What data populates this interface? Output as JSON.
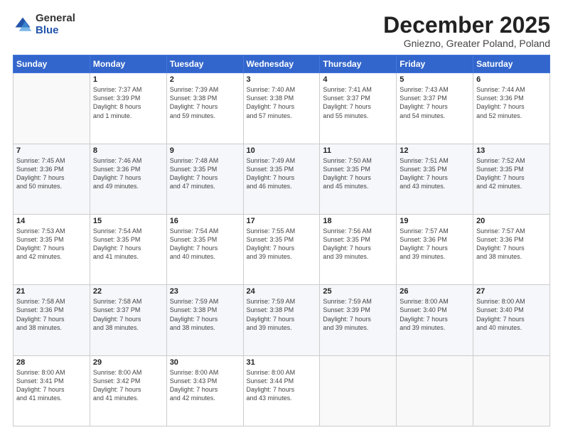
{
  "header": {
    "logo_general": "General",
    "logo_blue": "Blue",
    "title": "December 2025",
    "subtitle": "Gniezno, Greater Poland, Poland"
  },
  "weekdays": [
    "Sunday",
    "Monday",
    "Tuesday",
    "Wednesday",
    "Thursday",
    "Friday",
    "Saturday"
  ],
  "weeks": [
    [
      {
        "num": "",
        "info": ""
      },
      {
        "num": "1",
        "info": "Sunrise: 7:37 AM\nSunset: 3:39 PM\nDaylight: 8 hours\nand 1 minute."
      },
      {
        "num": "2",
        "info": "Sunrise: 7:39 AM\nSunset: 3:38 PM\nDaylight: 7 hours\nand 59 minutes."
      },
      {
        "num": "3",
        "info": "Sunrise: 7:40 AM\nSunset: 3:38 PM\nDaylight: 7 hours\nand 57 minutes."
      },
      {
        "num": "4",
        "info": "Sunrise: 7:41 AM\nSunset: 3:37 PM\nDaylight: 7 hours\nand 55 minutes."
      },
      {
        "num": "5",
        "info": "Sunrise: 7:43 AM\nSunset: 3:37 PM\nDaylight: 7 hours\nand 54 minutes."
      },
      {
        "num": "6",
        "info": "Sunrise: 7:44 AM\nSunset: 3:36 PM\nDaylight: 7 hours\nand 52 minutes."
      }
    ],
    [
      {
        "num": "7",
        "info": "Sunrise: 7:45 AM\nSunset: 3:36 PM\nDaylight: 7 hours\nand 50 minutes."
      },
      {
        "num": "8",
        "info": "Sunrise: 7:46 AM\nSunset: 3:36 PM\nDaylight: 7 hours\nand 49 minutes."
      },
      {
        "num": "9",
        "info": "Sunrise: 7:48 AM\nSunset: 3:35 PM\nDaylight: 7 hours\nand 47 minutes."
      },
      {
        "num": "10",
        "info": "Sunrise: 7:49 AM\nSunset: 3:35 PM\nDaylight: 7 hours\nand 46 minutes."
      },
      {
        "num": "11",
        "info": "Sunrise: 7:50 AM\nSunset: 3:35 PM\nDaylight: 7 hours\nand 45 minutes."
      },
      {
        "num": "12",
        "info": "Sunrise: 7:51 AM\nSunset: 3:35 PM\nDaylight: 7 hours\nand 43 minutes."
      },
      {
        "num": "13",
        "info": "Sunrise: 7:52 AM\nSunset: 3:35 PM\nDaylight: 7 hours\nand 42 minutes."
      }
    ],
    [
      {
        "num": "14",
        "info": "Sunrise: 7:53 AM\nSunset: 3:35 PM\nDaylight: 7 hours\nand 42 minutes."
      },
      {
        "num": "15",
        "info": "Sunrise: 7:54 AM\nSunset: 3:35 PM\nDaylight: 7 hours\nand 41 minutes."
      },
      {
        "num": "16",
        "info": "Sunrise: 7:54 AM\nSunset: 3:35 PM\nDaylight: 7 hours\nand 40 minutes."
      },
      {
        "num": "17",
        "info": "Sunrise: 7:55 AM\nSunset: 3:35 PM\nDaylight: 7 hours\nand 39 minutes."
      },
      {
        "num": "18",
        "info": "Sunrise: 7:56 AM\nSunset: 3:35 PM\nDaylight: 7 hours\nand 39 minutes."
      },
      {
        "num": "19",
        "info": "Sunrise: 7:57 AM\nSunset: 3:36 PM\nDaylight: 7 hours\nand 39 minutes."
      },
      {
        "num": "20",
        "info": "Sunrise: 7:57 AM\nSunset: 3:36 PM\nDaylight: 7 hours\nand 38 minutes."
      }
    ],
    [
      {
        "num": "21",
        "info": "Sunrise: 7:58 AM\nSunset: 3:36 PM\nDaylight: 7 hours\nand 38 minutes."
      },
      {
        "num": "22",
        "info": "Sunrise: 7:58 AM\nSunset: 3:37 PM\nDaylight: 7 hours\nand 38 minutes."
      },
      {
        "num": "23",
        "info": "Sunrise: 7:59 AM\nSunset: 3:38 PM\nDaylight: 7 hours\nand 38 minutes."
      },
      {
        "num": "24",
        "info": "Sunrise: 7:59 AM\nSunset: 3:38 PM\nDaylight: 7 hours\nand 39 minutes."
      },
      {
        "num": "25",
        "info": "Sunrise: 7:59 AM\nSunset: 3:39 PM\nDaylight: 7 hours\nand 39 minutes."
      },
      {
        "num": "26",
        "info": "Sunrise: 8:00 AM\nSunset: 3:40 PM\nDaylight: 7 hours\nand 39 minutes."
      },
      {
        "num": "27",
        "info": "Sunrise: 8:00 AM\nSunset: 3:40 PM\nDaylight: 7 hours\nand 40 minutes."
      }
    ],
    [
      {
        "num": "28",
        "info": "Sunrise: 8:00 AM\nSunset: 3:41 PM\nDaylight: 7 hours\nand 41 minutes."
      },
      {
        "num": "29",
        "info": "Sunrise: 8:00 AM\nSunset: 3:42 PM\nDaylight: 7 hours\nand 41 minutes."
      },
      {
        "num": "30",
        "info": "Sunrise: 8:00 AM\nSunset: 3:43 PM\nDaylight: 7 hours\nand 42 minutes."
      },
      {
        "num": "31",
        "info": "Sunrise: 8:00 AM\nSunset: 3:44 PM\nDaylight: 7 hours\nand 43 minutes."
      },
      {
        "num": "",
        "info": ""
      },
      {
        "num": "",
        "info": ""
      },
      {
        "num": "",
        "info": ""
      }
    ]
  ]
}
